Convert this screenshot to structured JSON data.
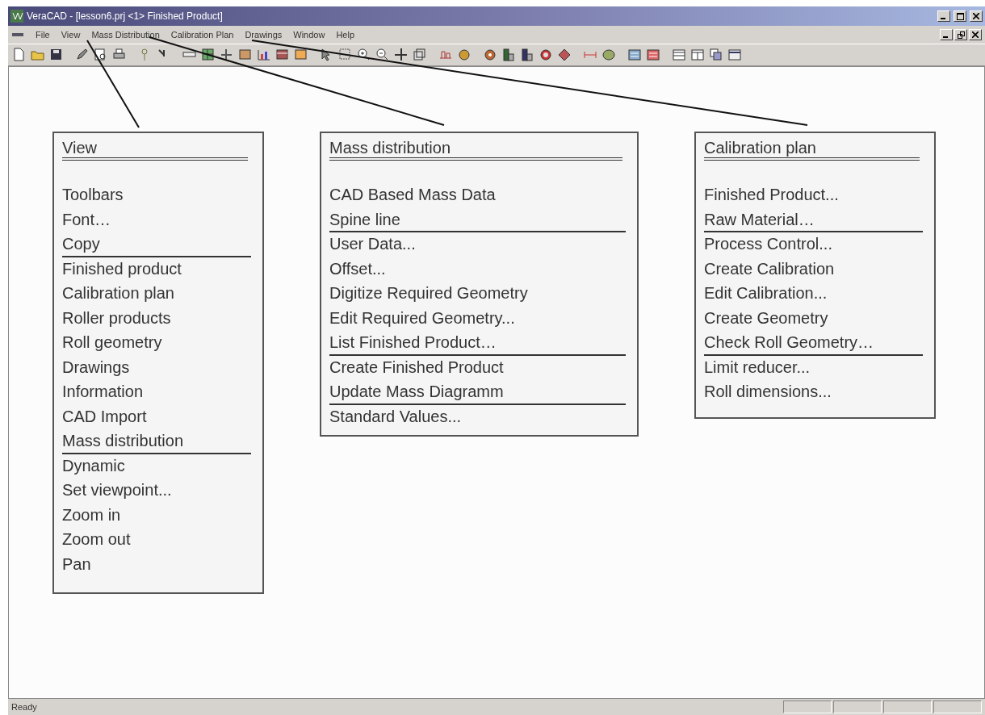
{
  "window": {
    "title": "VeraCAD - [lesson6.prj <1> Finished Product]"
  },
  "menu_bar": [
    {
      "label": "File"
    },
    {
      "label": "View"
    },
    {
      "label": "Mass Distribution"
    },
    {
      "label": "Calibration Plan"
    },
    {
      "label": "Drawings"
    },
    {
      "label": "Window"
    },
    {
      "label": "Help"
    }
  ],
  "menu_panels": [
    {
      "title": "View",
      "items": [
        {
          "label": "Toolbars",
          "separator": false
        },
        {
          "label": "Font…",
          "separator": false
        },
        {
          "label": "Copy",
          "separator": true
        },
        {
          "label": "Finished product",
          "separator": false
        },
        {
          "label": "Calibration plan",
          "separator": false
        },
        {
          "label": "Roller products",
          "separator": false
        },
        {
          "label": "Roll geometry",
          "separator": false
        },
        {
          "label": "Drawings",
          "separator": false
        },
        {
          "label": "Information",
          "separator": false
        },
        {
          "label": "CAD Import",
          "separator": false
        },
        {
          "label": "Mass distribution",
          "separator": true
        },
        {
          "label": "Dynamic",
          "separator": false
        },
        {
          "label": "Set viewpoint...",
          "separator": false
        },
        {
          "label": "Zoom in",
          "separator": false
        },
        {
          "label": "Zoom out",
          "separator": false
        },
        {
          "label": "Pan",
          "separator": false
        }
      ]
    },
    {
      "title": "Mass distribution",
      "items": [
        {
          "label": "CAD Based Mass Data",
          "separator": false
        },
        {
          "label": "Spine line",
          "separator": true
        },
        {
          "label": "User Data...",
          "separator": false
        },
        {
          "label": "Offset...",
          "separator": false
        },
        {
          "label": "Digitize Required Geometry",
          "separator": false
        },
        {
          "label": "Edit Required Geometry...",
          "separator": false
        },
        {
          "label": "List Finished Product…",
          "separator": true
        },
        {
          "label": "Create Finished Product",
          "separator": false
        },
        {
          "label": "Update Mass Diagramm",
          "separator": true
        },
        {
          "label": "Standard Values...",
          "separator": false
        }
      ]
    },
    {
      "title": "Calibration plan",
      "items": [
        {
          "label": "Finished Product...",
          "separator": false
        },
        {
          "label": "Raw Material…",
          "separator": true
        },
        {
          "label": "Process Control...",
          "separator": false
        },
        {
          "label": "Create Calibration",
          "separator": false
        },
        {
          "label": "Edit Calibration...",
          "separator": false
        },
        {
          "label": "Create Geometry",
          "separator": false
        },
        {
          "label": "Check Roll Geometry…",
          "separator": true
        },
        {
          "label": "Limit reducer...",
          "separator": false
        },
        {
          "label": "Roll dimensions...",
          "separator": false
        }
      ]
    }
  ],
  "status_bar": {
    "text": "Ready"
  }
}
